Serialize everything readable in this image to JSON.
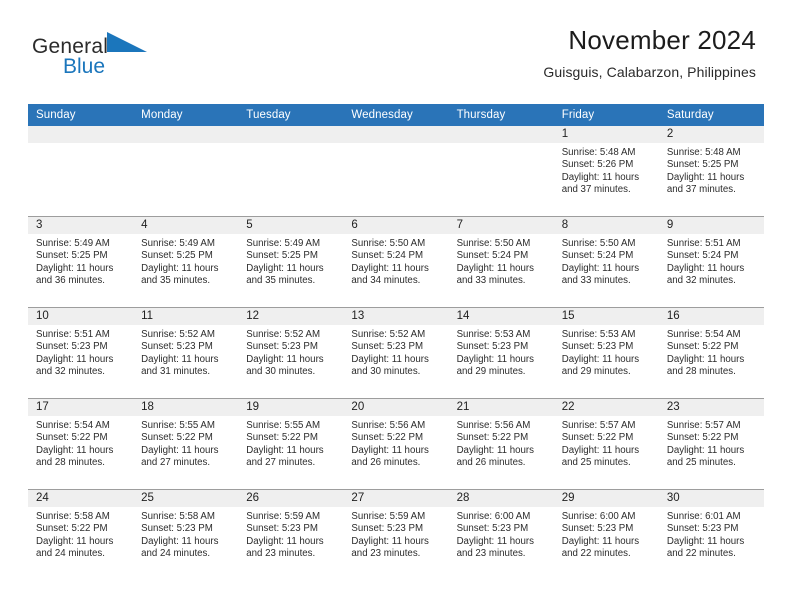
{
  "brand": {
    "name_part1": "General",
    "name_part2": "Blue",
    "triangle_color": "#1b76bc"
  },
  "header": {
    "title": "November 2024",
    "subtitle": "Guisguis, Calabarzon, Philippines"
  },
  "theme": {
    "header_row_bg": "#2a74b8",
    "header_row_text": "#ffffff",
    "daynum_band_bg": "#efefef",
    "grid_line": "#9d9d9d"
  },
  "weekday_headers": [
    "Sunday",
    "Monday",
    "Tuesday",
    "Wednesday",
    "Thursday",
    "Friday",
    "Saturday"
  ],
  "labels": {
    "sunrise_prefix": "Sunrise:",
    "sunset_prefix": "Sunset:",
    "daylight_prefix": "Daylight:"
  },
  "weeks": [
    [
      {
        "empty": true
      },
      {
        "empty": true
      },
      {
        "empty": true
      },
      {
        "empty": true
      },
      {
        "empty": true
      },
      {
        "day": "1",
        "sunrise": "Sunrise: 5:48 AM",
        "sunset": "Sunset: 5:26 PM",
        "daylight": "Daylight: 11 hours and 37 minutes."
      },
      {
        "day": "2",
        "sunrise": "Sunrise: 5:48 AM",
        "sunset": "Sunset: 5:25 PM",
        "daylight": "Daylight: 11 hours and 37 minutes."
      }
    ],
    [
      {
        "day": "3",
        "sunrise": "Sunrise: 5:49 AM",
        "sunset": "Sunset: 5:25 PM",
        "daylight": "Daylight: 11 hours and 36 minutes."
      },
      {
        "day": "4",
        "sunrise": "Sunrise: 5:49 AM",
        "sunset": "Sunset: 5:25 PM",
        "daylight": "Daylight: 11 hours and 35 minutes."
      },
      {
        "day": "5",
        "sunrise": "Sunrise: 5:49 AM",
        "sunset": "Sunset: 5:25 PM",
        "daylight": "Daylight: 11 hours and 35 minutes."
      },
      {
        "day": "6",
        "sunrise": "Sunrise: 5:50 AM",
        "sunset": "Sunset: 5:24 PM",
        "daylight": "Daylight: 11 hours and 34 minutes."
      },
      {
        "day": "7",
        "sunrise": "Sunrise: 5:50 AM",
        "sunset": "Sunset: 5:24 PM",
        "daylight": "Daylight: 11 hours and 33 minutes."
      },
      {
        "day": "8",
        "sunrise": "Sunrise: 5:50 AM",
        "sunset": "Sunset: 5:24 PM",
        "daylight": "Daylight: 11 hours and 33 minutes."
      },
      {
        "day": "9",
        "sunrise": "Sunrise: 5:51 AM",
        "sunset": "Sunset: 5:24 PM",
        "daylight": "Daylight: 11 hours and 32 minutes."
      }
    ],
    [
      {
        "day": "10",
        "sunrise": "Sunrise: 5:51 AM",
        "sunset": "Sunset: 5:23 PM",
        "daylight": "Daylight: 11 hours and 32 minutes."
      },
      {
        "day": "11",
        "sunrise": "Sunrise: 5:52 AM",
        "sunset": "Sunset: 5:23 PM",
        "daylight": "Daylight: 11 hours and 31 minutes."
      },
      {
        "day": "12",
        "sunrise": "Sunrise: 5:52 AM",
        "sunset": "Sunset: 5:23 PM",
        "daylight": "Daylight: 11 hours and 30 minutes."
      },
      {
        "day": "13",
        "sunrise": "Sunrise: 5:52 AM",
        "sunset": "Sunset: 5:23 PM",
        "daylight": "Daylight: 11 hours and 30 minutes."
      },
      {
        "day": "14",
        "sunrise": "Sunrise: 5:53 AM",
        "sunset": "Sunset: 5:23 PM",
        "daylight": "Daylight: 11 hours and 29 minutes."
      },
      {
        "day": "15",
        "sunrise": "Sunrise: 5:53 AM",
        "sunset": "Sunset: 5:23 PM",
        "daylight": "Daylight: 11 hours and 29 minutes."
      },
      {
        "day": "16",
        "sunrise": "Sunrise: 5:54 AM",
        "sunset": "Sunset: 5:22 PM",
        "daylight": "Daylight: 11 hours and 28 minutes."
      }
    ],
    [
      {
        "day": "17",
        "sunrise": "Sunrise: 5:54 AM",
        "sunset": "Sunset: 5:22 PM",
        "daylight": "Daylight: 11 hours and 28 minutes."
      },
      {
        "day": "18",
        "sunrise": "Sunrise: 5:55 AM",
        "sunset": "Sunset: 5:22 PM",
        "daylight": "Daylight: 11 hours and 27 minutes."
      },
      {
        "day": "19",
        "sunrise": "Sunrise: 5:55 AM",
        "sunset": "Sunset: 5:22 PM",
        "daylight": "Daylight: 11 hours and 27 minutes."
      },
      {
        "day": "20",
        "sunrise": "Sunrise: 5:56 AM",
        "sunset": "Sunset: 5:22 PM",
        "daylight": "Daylight: 11 hours and 26 minutes."
      },
      {
        "day": "21",
        "sunrise": "Sunrise: 5:56 AM",
        "sunset": "Sunset: 5:22 PM",
        "daylight": "Daylight: 11 hours and 26 minutes."
      },
      {
        "day": "22",
        "sunrise": "Sunrise: 5:57 AM",
        "sunset": "Sunset: 5:22 PM",
        "daylight": "Daylight: 11 hours and 25 minutes."
      },
      {
        "day": "23",
        "sunrise": "Sunrise: 5:57 AM",
        "sunset": "Sunset: 5:22 PM",
        "daylight": "Daylight: 11 hours and 25 minutes."
      }
    ],
    [
      {
        "day": "24",
        "sunrise": "Sunrise: 5:58 AM",
        "sunset": "Sunset: 5:22 PM",
        "daylight": "Daylight: 11 hours and 24 minutes."
      },
      {
        "day": "25",
        "sunrise": "Sunrise: 5:58 AM",
        "sunset": "Sunset: 5:23 PM",
        "daylight": "Daylight: 11 hours and 24 minutes."
      },
      {
        "day": "26",
        "sunrise": "Sunrise: 5:59 AM",
        "sunset": "Sunset: 5:23 PM",
        "daylight": "Daylight: 11 hours and 23 minutes."
      },
      {
        "day": "27",
        "sunrise": "Sunrise: 5:59 AM",
        "sunset": "Sunset: 5:23 PM",
        "daylight": "Daylight: 11 hours and 23 minutes."
      },
      {
        "day": "28",
        "sunrise": "Sunrise: 6:00 AM",
        "sunset": "Sunset: 5:23 PM",
        "daylight": "Daylight: 11 hours and 23 minutes."
      },
      {
        "day": "29",
        "sunrise": "Sunrise: 6:00 AM",
        "sunset": "Sunset: 5:23 PM",
        "daylight": "Daylight: 11 hours and 22 minutes."
      },
      {
        "day": "30",
        "sunrise": "Sunrise: 6:01 AM",
        "sunset": "Sunset: 5:23 PM",
        "daylight": "Daylight: 11 hours and 22 minutes."
      }
    ]
  ]
}
